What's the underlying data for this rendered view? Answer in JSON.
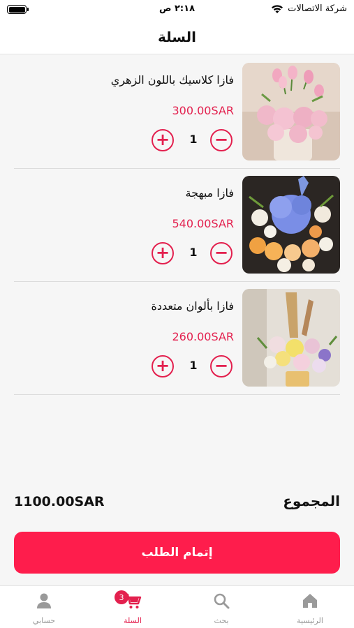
{
  "status_bar": {
    "carrier": "شركة الاتصالات",
    "time": "٢:١٨ ص",
    "icons": [
      "wifi-icon",
      "battery-icon"
    ]
  },
  "header": {
    "title": "السلة"
  },
  "cart": {
    "items": [
      {
        "name": "فازا كلاسيك باللون الزهري",
        "price": "300.00SAR",
        "quantity": "1",
        "image": "pink-flower-vase"
      },
      {
        "name": "فازا مبهجة",
        "price": "540.00SAR",
        "quantity": "1",
        "image": "blue-hydrangea-bouquet"
      },
      {
        "name": "فازا بألوان متعددة",
        "price": "260.00SAR",
        "quantity": "1",
        "image": "multicolor-flower-vase"
      }
    ],
    "plus_icon": "plus-icon",
    "minus_icon": "minus-icon"
  },
  "summary": {
    "total_label": "المجموع",
    "total_value": "1100.00SAR"
  },
  "checkout": {
    "label": "إتمام الطلب"
  },
  "tab_bar": {
    "tabs": [
      {
        "label": "الرئيسية",
        "icon": "home-icon",
        "active": false
      },
      {
        "label": "بحث",
        "icon": "search-icon",
        "active": false
      },
      {
        "label": "السلة",
        "icon": "cart-icon",
        "active": true,
        "badge": "3"
      },
      {
        "label": "حسابي",
        "icon": "person-icon",
        "active": false
      }
    ]
  },
  "colors": {
    "accent": "#e3204e",
    "button": "#fe1d4c",
    "background": "#f6f6f6"
  }
}
